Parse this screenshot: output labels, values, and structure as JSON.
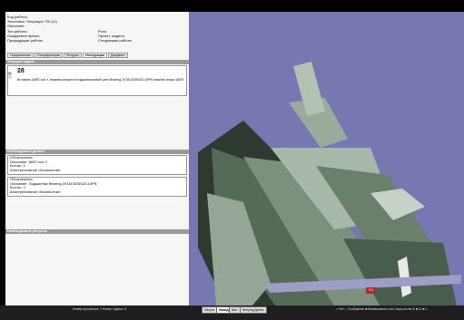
{
  "work": {
    "code_label": "Код работы:",
    "filling_label": "Заголовок: Операции 700 (г1)",
    "description_label": "Описание:",
    "type_label": "Тип работы:",
    "role_label": "Роль:",
    "time_label": "Ожидаемое время:",
    "project_label": "Проект, модель:",
    "prev_label": "Предыдущая работа:",
    "next_label": "Следующая работа:"
  },
  "tabs": [
    {
      "label": "Предпосылки"
    },
    {
      "label": "Спецификация"
    },
    {
      "label": "Ресурсы"
    },
    {
      "label": "Инструкция"
    },
    {
      "label": "Документ"
    }
  ],
  "current_task": {
    "header": "Текущая задача",
    "step_tag": "б1",
    "number": "28",
    "text": "Вставить ШВП оси Х нижним концом в подшипниковый узел Bearing 20TAC62BSUC10PN нижней опоры ШВП."
  },
  "parts": {
    "header": "Необходимые детали",
    "items": [
      {
        "lines": [
          "Обозначение:",
          "Описание: ШВП оси Х",
          "Кол-во: 1",
          "Альтернативное обозначение:"
        ]
      },
      {
        "lines": [
          "Обозначение:",
          "Описание: Подшипник Bearing 20TAC62BSUC10PN",
          "Кол-во: 2",
          "Альтернативное обозначение:"
        ]
      }
    ]
  },
  "resources": {
    "header": "Необходимые ресурсы"
  },
  "bottom": {
    "left_status": "Номер просмотра: 1   Номер задачи: 8",
    "buttons": [
      "Запуск",
      "Назад",
      "Шаг",
      "Вперед/Далее"
    ],
    "right_status": "□ Нет  □ Сообщение  ■ Взаимосвязи  стоп   Скорость ■ 10 ■ 11 ■ 1"
  },
  "marker": {
    "label": "0.0"
  },
  "colors": {
    "viewport": "#7777b1",
    "header_bar": "#9a9a9a",
    "marker": "#c8202a"
  },
  "icons": [
    "part-marker-icon"
  ]
}
